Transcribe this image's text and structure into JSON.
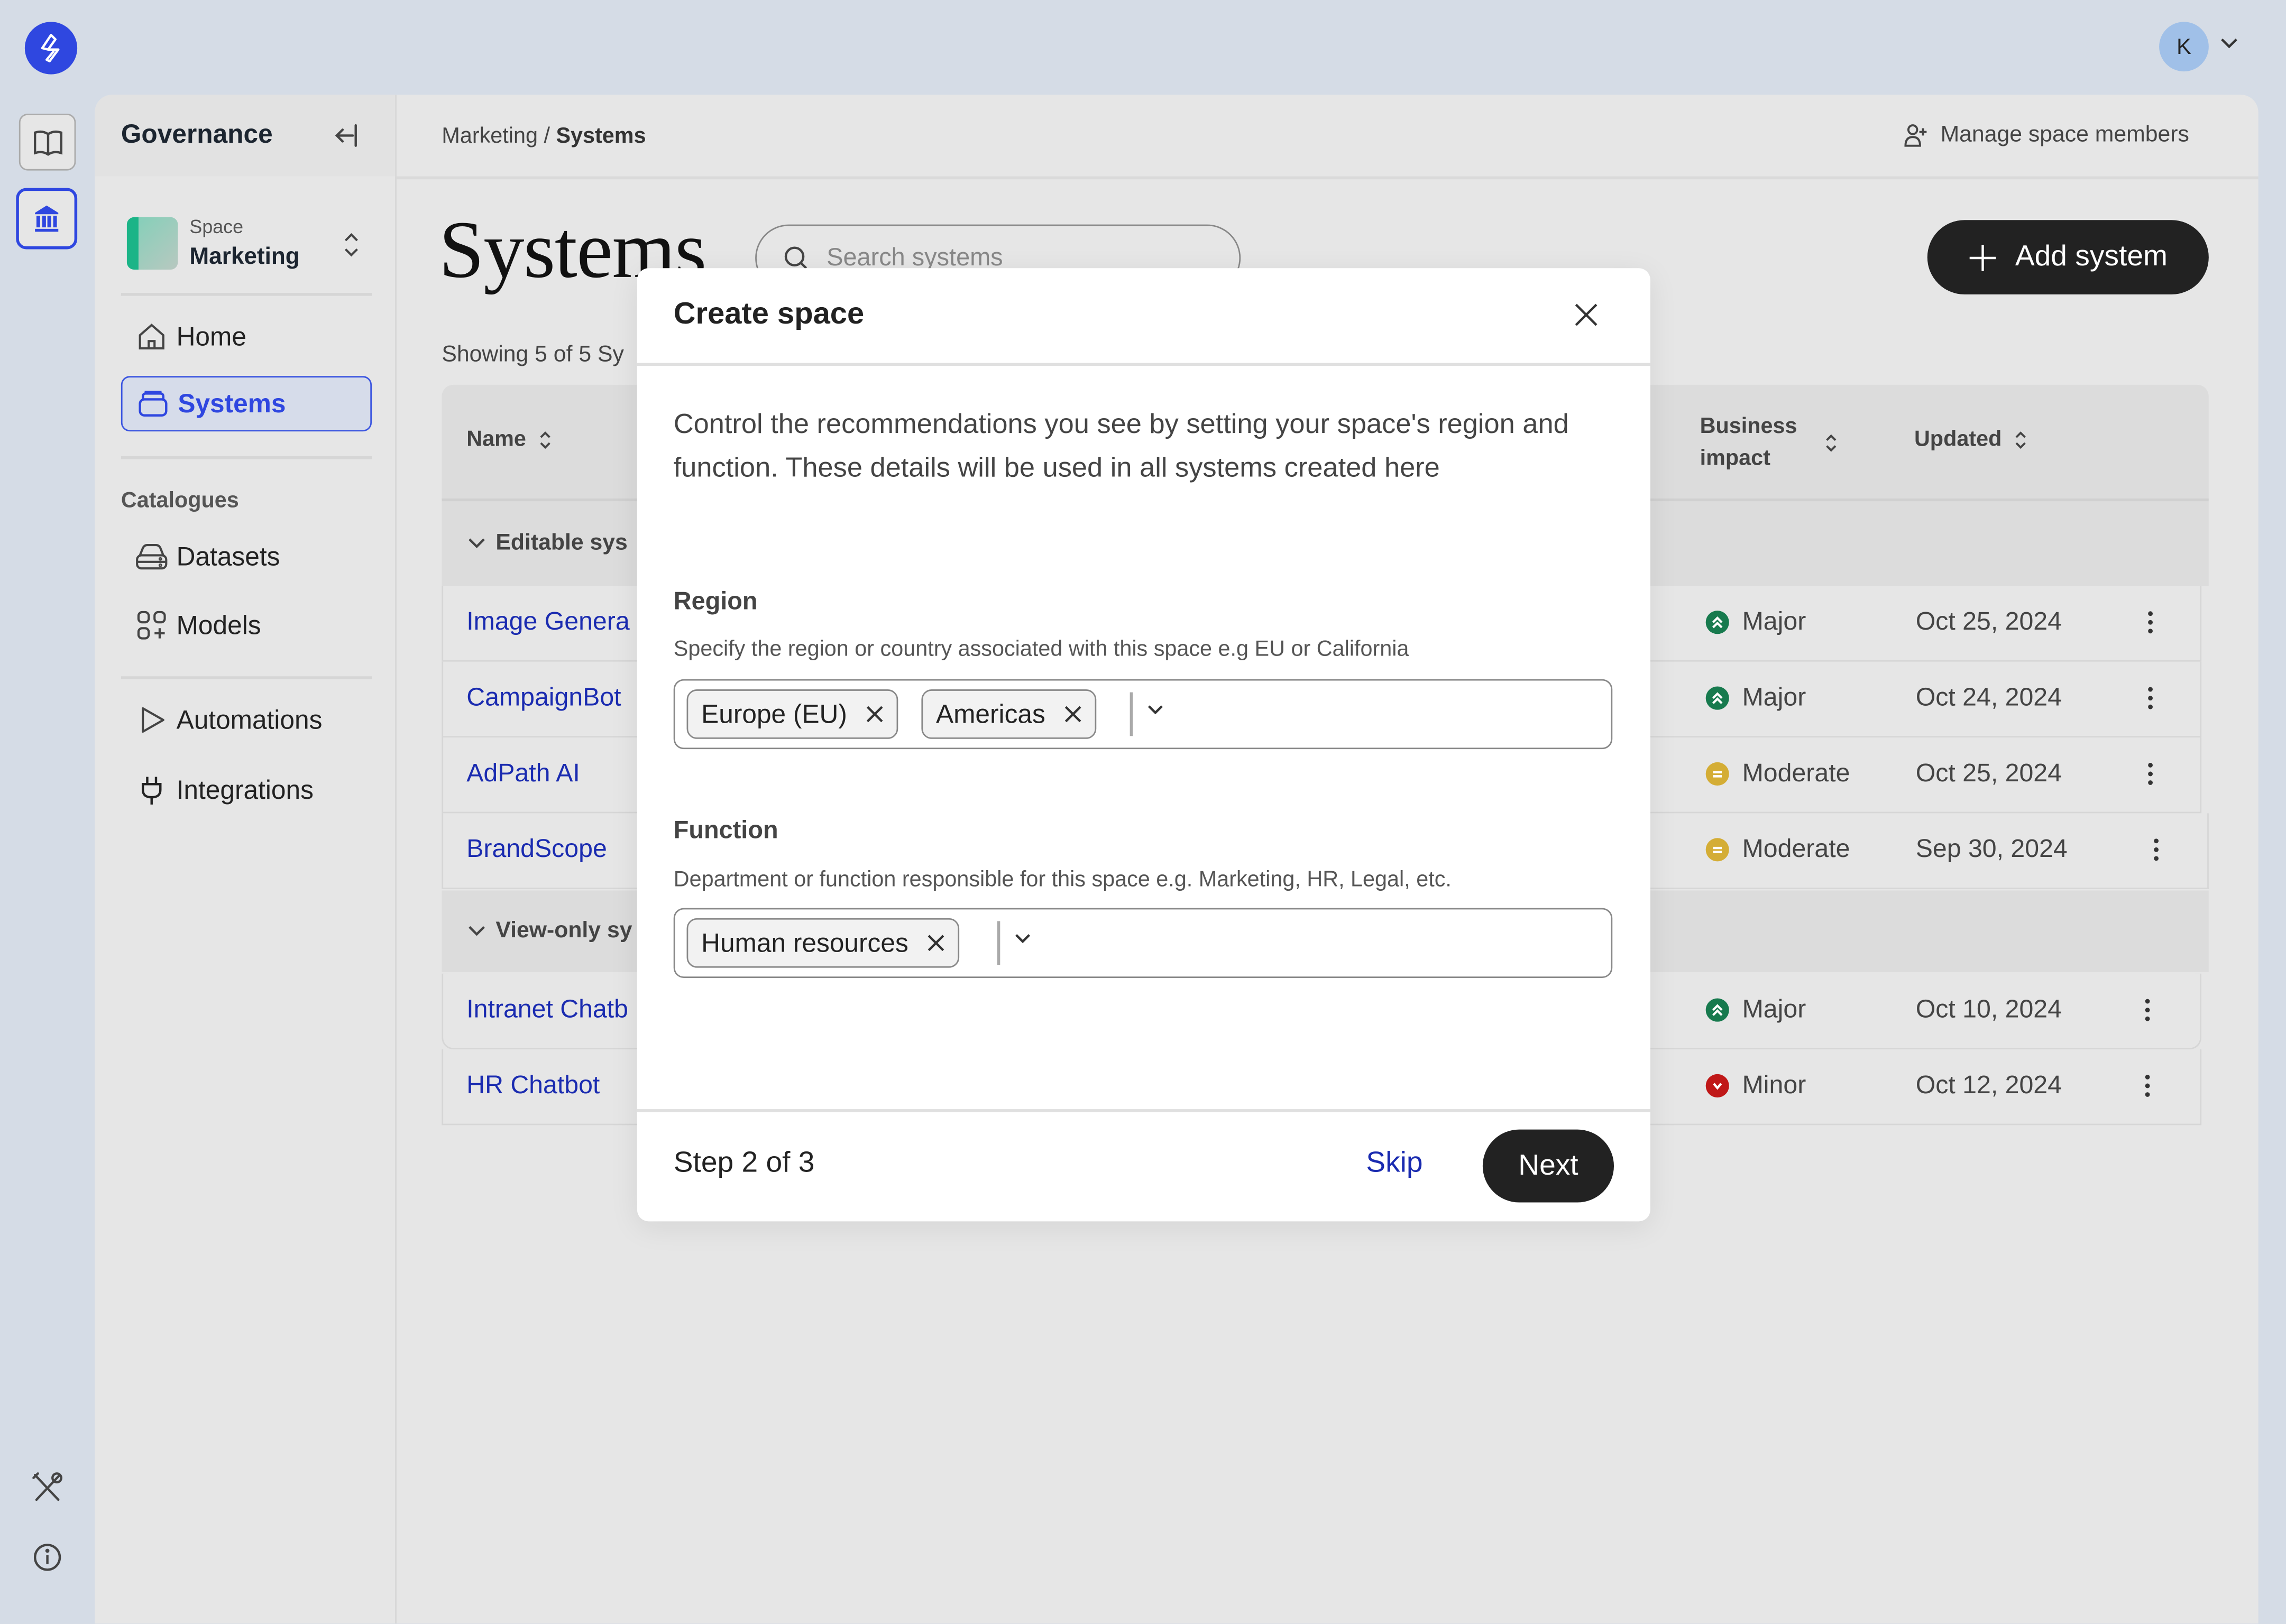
{
  "app": {
    "user_initial": "K"
  },
  "sidebar": {
    "title": "Governance",
    "space": {
      "label": "Space",
      "name": "Marketing"
    },
    "nav": [
      {
        "label": "Home",
        "icon": "home-icon"
      },
      {
        "label": "Systems",
        "icon": "systems-icon",
        "active": true
      }
    ],
    "catalogues_label": "Catalogues",
    "catalogues": [
      {
        "label": "Datasets",
        "icon": "datasets-icon"
      },
      {
        "label": "Models",
        "icon": "models-icon"
      }
    ],
    "tools": [
      {
        "label": "Automations",
        "icon": "play-icon"
      },
      {
        "label": "Integrations",
        "icon": "plug-icon"
      }
    ]
  },
  "topbar": {
    "breadcrumb_parent": "Marketing",
    "breadcrumb_sep": "/",
    "breadcrumb_current": "Systems",
    "manage_members": "Manage space members"
  },
  "page": {
    "title": "Systems",
    "search_placeholder": "Search systems",
    "add_button": "Add system",
    "showing": "Showing 5 of 5 Sy"
  },
  "table": {
    "columns": {
      "name": "Name",
      "impact": "Business impact",
      "impact_line1": "Business",
      "impact_line2": "impact",
      "updated": "Updated"
    },
    "groups": [
      {
        "label": "Editable sys",
        "rows": [
          {
            "name": "Image Genera",
            "impact": "Major",
            "updated": "Oct 25, 2024"
          },
          {
            "name": "CampaignBot",
            "impact": "Major",
            "updated": "Oct 24, 2024"
          },
          {
            "name": "AdPath AI",
            "impact": "Moderate",
            "updated": "Oct 25, 2024"
          },
          {
            "name": "BrandScope",
            "impact": "Moderate",
            "updated": "Sep 30, 2024"
          }
        ]
      },
      {
        "label": "View-only sy",
        "rows": [
          {
            "name": "Intranet Chatb",
            "impact": "Major",
            "updated": "Oct 10, 2024"
          },
          {
            "name": "HR Chatbot",
            "impact": "Minor",
            "updated": "Oct 12, 2024"
          }
        ]
      }
    ],
    "impact_colors": {
      "Major": "#177a4e",
      "Moderate": "#d4ad35",
      "Minor": "#c01818"
    }
  },
  "modal": {
    "title": "Create space",
    "description": "Control the recommendations you see by setting your space's region and function. These details will be used in all systems created here",
    "region": {
      "label": "Region",
      "help": "Specify the region or country associated with this space e.g EU or California",
      "selected": [
        "Europe (EU)",
        "Americas"
      ]
    },
    "function": {
      "label": "Function",
      "help": "Department or function responsible for this space e.g. Marketing, HR, Legal, etc.",
      "selected": [
        "Human resources"
      ]
    },
    "step": "Step 2 of 3",
    "skip": "Skip",
    "next": "Next"
  }
}
